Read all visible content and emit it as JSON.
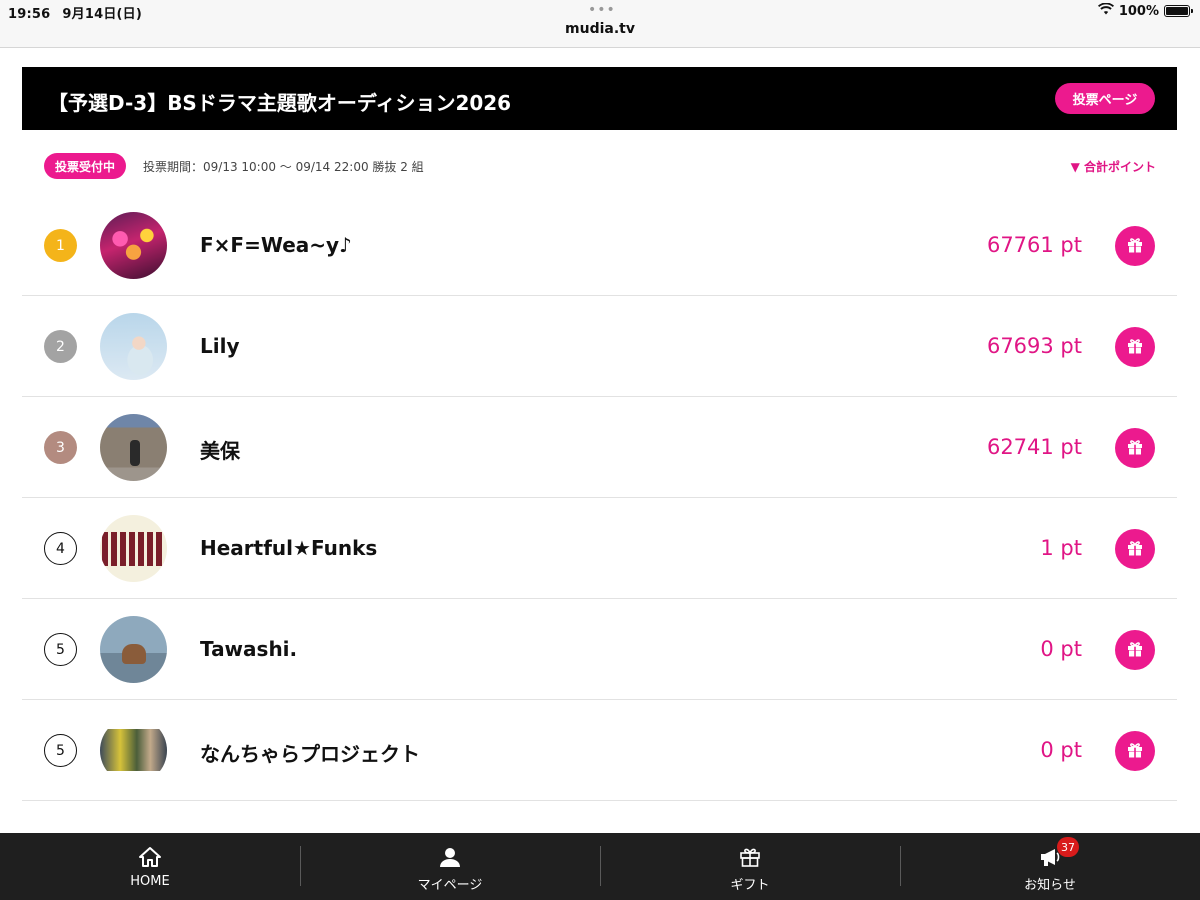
{
  "status_bar": {
    "time": "19:56",
    "date": "9月14日(日)",
    "url": "mudia.tv",
    "battery": "100%",
    "battery_level": 1.0,
    "dots": "•••"
  },
  "header": {
    "title": "【予選D-3】BSドラマ主題歌オーディション2026",
    "vote_page_label": "投票ページ"
  },
  "info": {
    "status_badge": "投票受付中",
    "vote_period": "投票期間：09/13 10:00 〜 09/14 22:00 勝抜 2 組",
    "sort_label": "▼ 合計ポイント"
  },
  "ranking": [
    {
      "rank": "1",
      "name": "F×F=Wea~y♪",
      "points": "67761 pt"
    },
    {
      "rank": "2",
      "name": "Lily",
      "points": "67693 pt"
    },
    {
      "rank": "3",
      "name": "美保",
      "points": "62741 pt"
    },
    {
      "rank": "4",
      "name": "Heartful★Funks",
      "points": "1 pt"
    },
    {
      "rank": "5",
      "name": "Tawashi.",
      "points": "0 pt"
    },
    {
      "rank": "5",
      "name": "なんちゃらプロジェクト",
      "points": "0 pt"
    }
  ],
  "tab_bar": {
    "tabs": [
      {
        "label": "HOME",
        "icon": "home-icon"
      },
      {
        "label": "マイページ",
        "icon": "user-icon"
      },
      {
        "label": "ギフト",
        "icon": "gift-icon"
      },
      {
        "label": "お知らせ",
        "icon": "megaphone-icon"
      }
    ],
    "notification_count": "37"
  },
  "colors": {
    "accent": "#ec1a8e",
    "header_bg": "#000000",
    "tab_bar_bg": "#1f1f1f",
    "rank_gold": "#f4b41a",
    "rank_silver": "#a3a3a3",
    "rank_bronze": "#b38b80"
  }
}
